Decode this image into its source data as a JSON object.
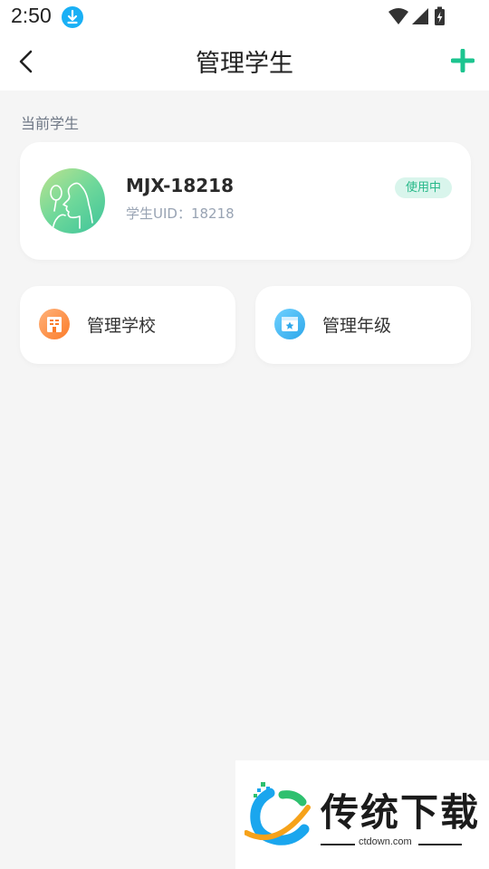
{
  "status_bar": {
    "time": "2:50"
  },
  "header": {
    "title": "管理学生"
  },
  "current_student": {
    "section_label": "当前学生",
    "name": "MJX-18218",
    "uid_label": "学生UID：",
    "uid_value": "18218",
    "status": "使用中"
  },
  "actions": [
    {
      "label": "管理学校",
      "icon": "school-icon"
    },
    {
      "label": "管理年级",
      "icon": "grade-icon"
    }
  ],
  "watermark": {
    "title": "传统下载",
    "url": "ctdown.com"
  },
  "colors": {
    "accent": "#1cc48f",
    "badge_bg": "#d9f5ec",
    "badge_text": "#26b889",
    "school_icon": "#fb7c2a",
    "grade_icon": "#2ea7ea"
  }
}
